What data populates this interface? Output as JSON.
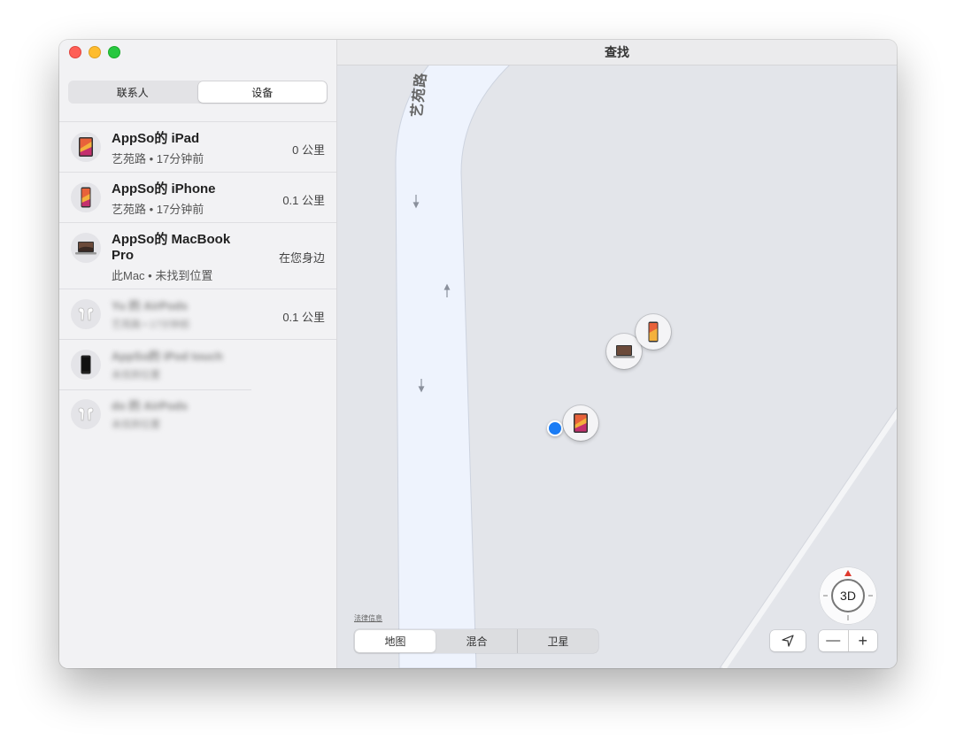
{
  "window": {
    "title": "查找"
  },
  "sidebar": {
    "tabs": [
      "联系人",
      "设备"
    ],
    "active_tab": "设备",
    "devices": [
      {
        "name": "AppSo的 iPad",
        "name_line2": "",
        "subtitle": "艺苑路 • 17分钟前",
        "distance": "0 公里",
        "icon": "ipad-icon"
      },
      {
        "name": "AppSo的 iPhone",
        "name_line2": "",
        "subtitle": "艺苑路 • 17分钟前",
        "distance": "0.1 公里",
        "icon": "iphone-icon"
      },
      {
        "name": "AppSo的 MacBook",
        "name_line2": "Pro",
        "subtitle": "此Mac • 未找到位置",
        "distance": "在您身边",
        "icon": "macbook-icon"
      },
      {
        "name": "Yu 的 AirPods",
        "name_line2": "",
        "subtitle": "艺苑路 • 17分钟前",
        "distance": "0.1 公里",
        "icon": "airpods-icon",
        "blurred": true
      },
      {
        "name": "AppSo的 iPod touch",
        "name_line2": "",
        "subtitle": "未找到位置",
        "distance": "",
        "icon": "ipod-icon",
        "blurred": true
      },
      {
        "name": "do 的 AirPods",
        "name_line2": "",
        "subtitle": "未找到位置",
        "distance": "",
        "icon": "airpods-icon",
        "blurred": true
      }
    ]
  },
  "map": {
    "road_label": "艺苑路",
    "legal_link": "法律信息",
    "map_types": [
      "地图",
      "混合",
      "卫星"
    ],
    "active_map_type": "地图",
    "compass_label": "3D",
    "zoom_out": "—",
    "zoom_in": "+",
    "location_icon": "location-arrow-icon"
  },
  "colors": {
    "accent_blue": "#1a7cf5",
    "map_background": "#e3e5ea",
    "road": "#eef3fd",
    "compass_north": "#e0392e"
  }
}
